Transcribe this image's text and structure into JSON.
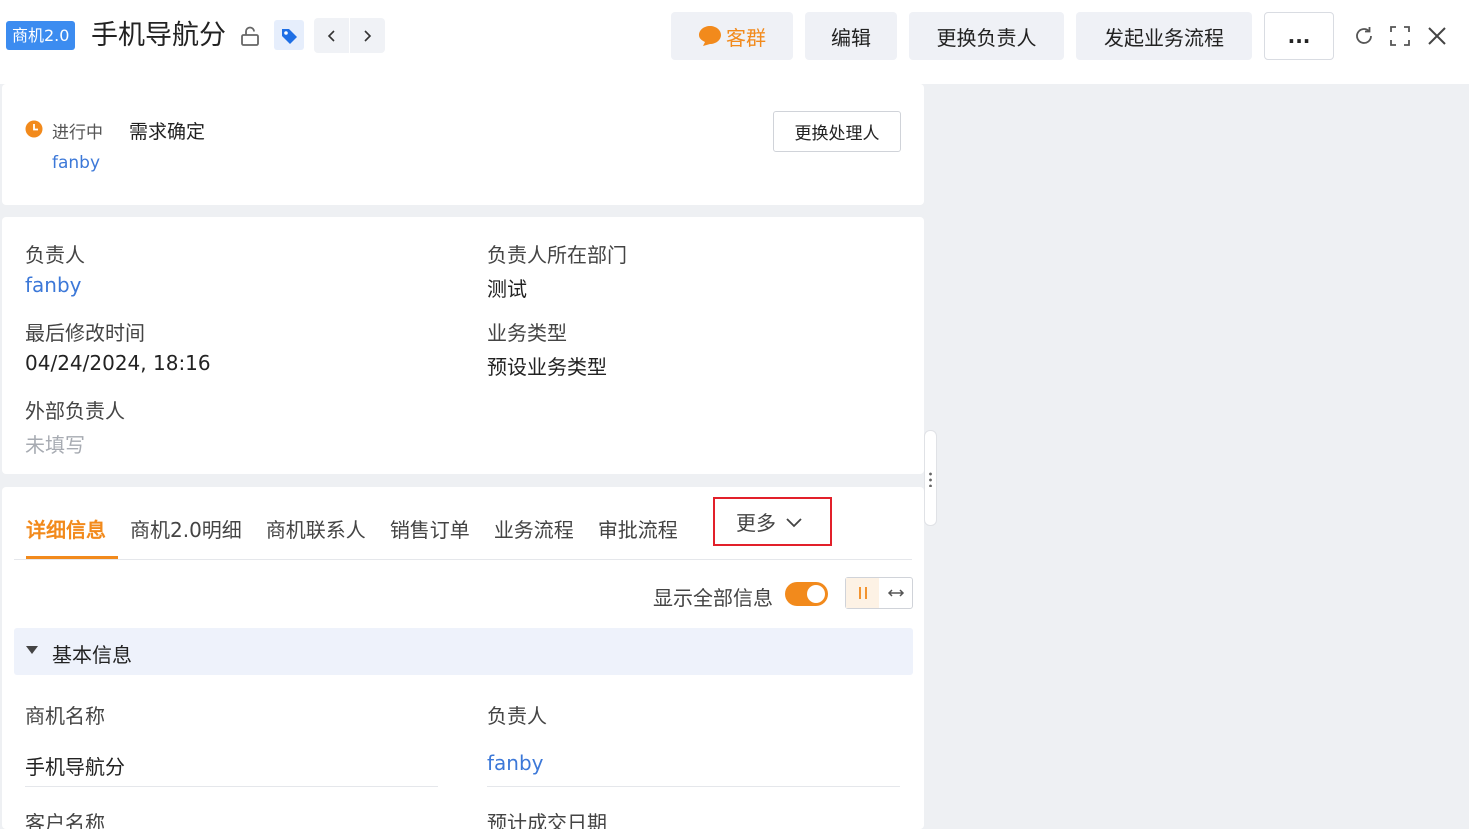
{
  "header": {
    "badge": "商机2.0",
    "title": "手机导航分",
    "buttons": {
      "kequn": "客群",
      "edit": "编辑",
      "change_owner": "更换负责人",
      "start_flow": "发起业务流程",
      "more": "..."
    },
    "nav_prev": "‹",
    "nav_next": "›"
  },
  "stage": {
    "status": "进行中",
    "name": "需求确定",
    "owner": "fanby",
    "change_handler": "更换处理人"
  },
  "summary": {
    "owner_label": "负责人",
    "owner_value": "fanby",
    "dept_label": "负责人所在部门",
    "dept_value": "测试",
    "modified_label": "最后修改时间",
    "modified_value": "04/24/2024, 18:16",
    "biz_type_label": "业务类型",
    "biz_type_value": "预设业务类型",
    "external_owner_label": "外部负责人",
    "external_owner_value": "未填写"
  },
  "tabs": {
    "items": [
      "详细信息",
      "商机2.0明细",
      "商机联系人",
      "销售订单",
      "业务流程",
      "审批流程"
    ],
    "more": "更多"
  },
  "detail": {
    "show_all_label": "显示全部信息",
    "section_title": "基本信息",
    "name_label": "商机名称",
    "name_value": "手机导航分",
    "owner_label": "负责人",
    "owner_value": "fanby",
    "customer_label": "客户名称",
    "expected_date_label": "预计成交日期"
  },
  "colors": {
    "accent": "#f28a1c",
    "link": "#3c78d8",
    "badge": "#3c8cf0",
    "highlight_box": "#e2202a"
  }
}
